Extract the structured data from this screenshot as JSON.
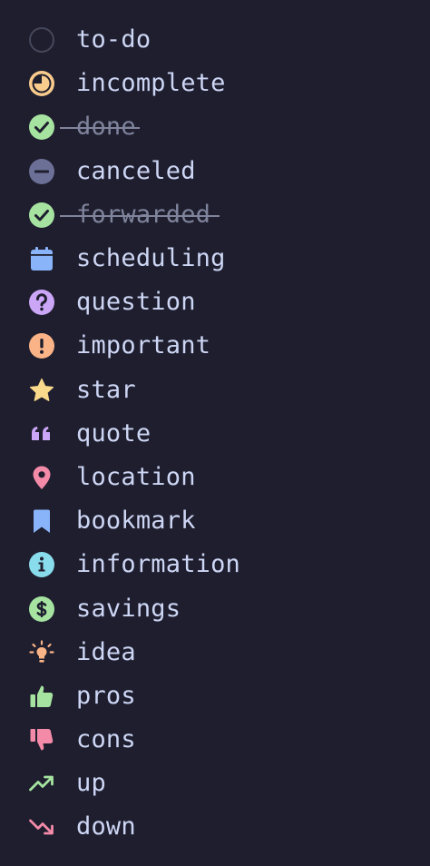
{
  "colors": {
    "background": "#1e1e2e",
    "text": "#cdd6f4",
    "struck_text": "#7f849c",
    "todo_outline": "#45475a",
    "incomplete": "#f9cb8c",
    "done": "#a6e3a1",
    "canceled": "#6c7096",
    "scheduling": "#89b4fa",
    "question": "#cba6f7",
    "important": "#fab387",
    "star": "#f9d98c",
    "quote": "#cba6f7",
    "location": "#f38ba8",
    "bookmark": "#89b4fa",
    "information": "#89dceb",
    "savings": "#a6e3a1",
    "idea": "#fab387",
    "pros": "#a6e3a1",
    "cons": "#f38ba8",
    "up": "#a6e3a1",
    "down": "#f38ba8"
  },
  "items": [
    {
      "label": "to-do",
      "icon": "empty-circle-icon"
    },
    {
      "label": "incomplete",
      "icon": "half-circle-icon"
    },
    {
      "label": "done",
      "icon": "check-circle-icon"
    },
    {
      "label": "canceled",
      "icon": "minus-circle-icon"
    },
    {
      "label": "forwarded",
      "icon": "check-circle-icon"
    },
    {
      "label": "scheduling",
      "icon": "calendar-icon"
    },
    {
      "label": "question",
      "icon": "question-circle-icon"
    },
    {
      "label": "important",
      "icon": "exclamation-circle-icon"
    },
    {
      "label": "star",
      "icon": "star-icon"
    },
    {
      "label": "quote",
      "icon": "quote-icon"
    },
    {
      "label": "location",
      "icon": "map-pin-icon"
    },
    {
      "label": "bookmark",
      "icon": "bookmark-icon"
    },
    {
      "label": "information",
      "icon": "info-circle-icon"
    },
    {
      "label": "savings",
      "icon": "dollar-circle-icon"
    },
    {
      "label": "idea",
      "icon": "lightbulb-icon"
    },
    {
      "label": "pros",
      "icon": "thumbs-up-icon"
    },
    {
      "label": "cons",
      "icon": "thumbs-down-icon"
    },
    {
      "label": "up",
      "icon": "trend-up-icon"
    },
    {
      "label": "down",
      "icon": "trend-down-icon"
    }
  ]
}
